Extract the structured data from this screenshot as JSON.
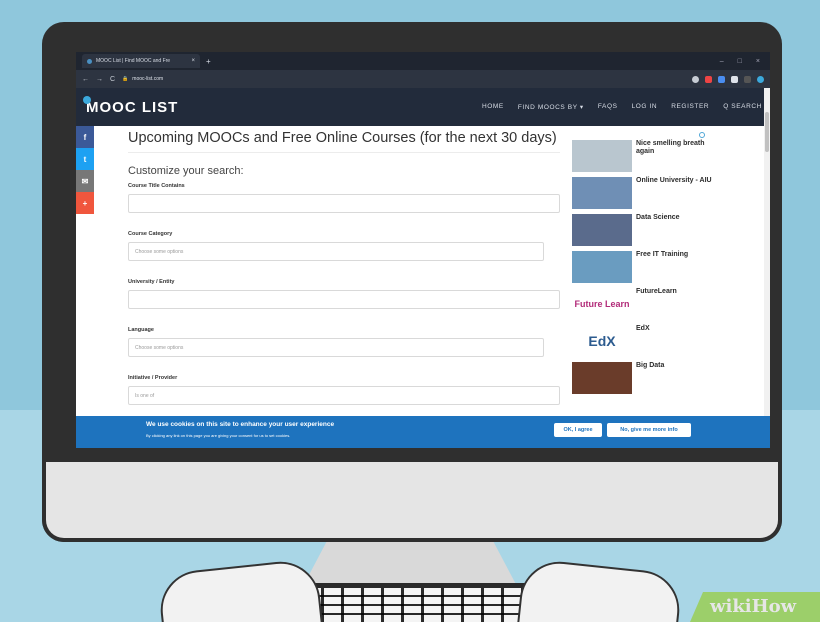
{
  "browser": {
    "tab_title": "MOOC List | Find MOOC and Fre",
    "tab_close": "×",
    "new_tab": "+",
    "back": "←",
    "forward": "→",
    "reload": "C",
    "url": "mooc-list.com",
    "window_controls": [
      "–",
      "□",
      "×"
    ]
  },
  "site": {
    "logo": "MOOC LIST",
    "nav": [
      "HOME",
      "FIND MOOCS BY ▾",
      "FAQS",
      "LOG IN",
      "REGISTER",
      "Q SEARCH"
    ]
  },
  "share": [
    {
      "label": "f",
      "color": "#3b5998"
    },
    {
      "label": "t",
      "color": "#1da1f2"
    },
    {
      "label": "✉",
      "color": "#777777"
    },
    {
      "label": "+",
      "color": "#f0563d"
    }
  ],
  "main": {
    "title": "Upcoming MOOCs and Free Online Courses (for the next 30 days)",
    "subtitle": "Customize your search:",
    "fields": [
      {
        "label": "Course Title Contains",
        "value": ""
      },
      {
        "label": "Course Category",
        "value": "Choose some options"
      },
      {
        "label": "University / Entity",
        "value": ""
      },
      {
        "label": "Language",
        "value": "Choose some options"
      },
      {
        "label": "Initiative / Provider",
        "value": "Is one of"
      }
    ]
  },
  "sidebar": {
    "items": [
      {
        "title": "Nice smelling breath again",
        "thumb": "#b9c6cf"
      },
      {
        "title": "Online University - AIU",
        "thumb": "#6f8fb5"
      },
      {
        "title": "Data Science",
        "thumb": "#5a6b8c"
      },
      {
        "title": "Free IT Training",
        "thumb": "#6a9cc0"
      },
      {
        "title": "FutureLearn",
        "thumb": "#ffffff"
      },
      {
        "title": "EdX",
        "thumb": "#ffffff"
      },
      {
        "title": "Big Data",
        "thumb": "#6a3c2a"
      }
    ]
  },
  "cookie": {
    "title": "We use cookies on this site to enhance your user experience",
    "text": "By clicking any link on this page you are giving your consent for us to set cookies.",
    "agree": "OK, I agree",
    "more": "No, give me more info"
  },
  "watermark": "wikiHow"
}
